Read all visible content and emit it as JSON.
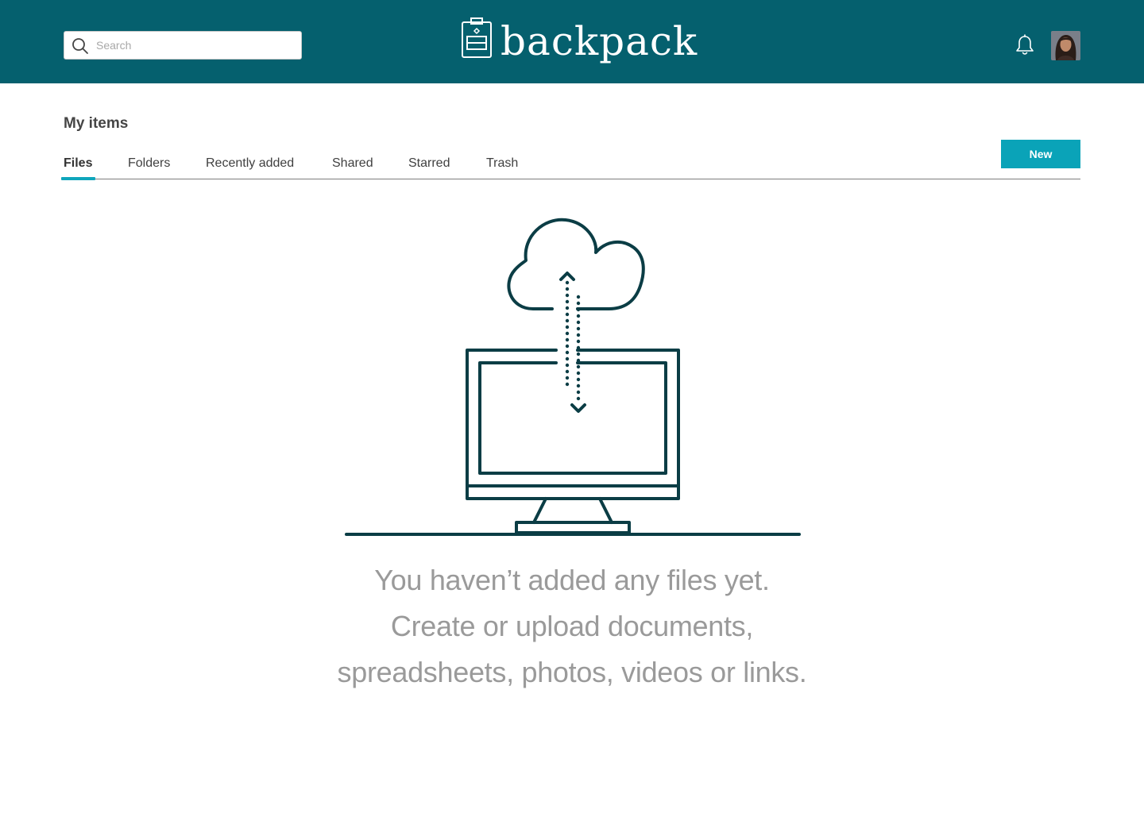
{
  "header": {
    "search": {
      "placeholder": "Search",
      "value": ""
    },
    "brand_name": "backpack",
    "colors": {
      "bar": "#05606e",
      "accent": "#0aa3b8"
    }
  },
  "main": {
    "title": "My items",
    "tabs": [
      {
        "label": "Files",
        "active": true
      },
      {
        "label": "Folders",
        "active": false
      },
      {
        "label": "Recently added",
        "active": false
      },
      {
        "label": "Shared",
        "active": false
      },
      {
        "label": "Starred",
        "active": false
      },
      {
        "label": "Trash",
        "active": false
      }
    ],
    "new_button_label": "New",
    "empty_state": {
      "lines": [
        "You haven’t added any files yet.",
        "Create or upload documents,",
        "spreadsheets, photos, videos or links."
      ]
    }
  }
}
